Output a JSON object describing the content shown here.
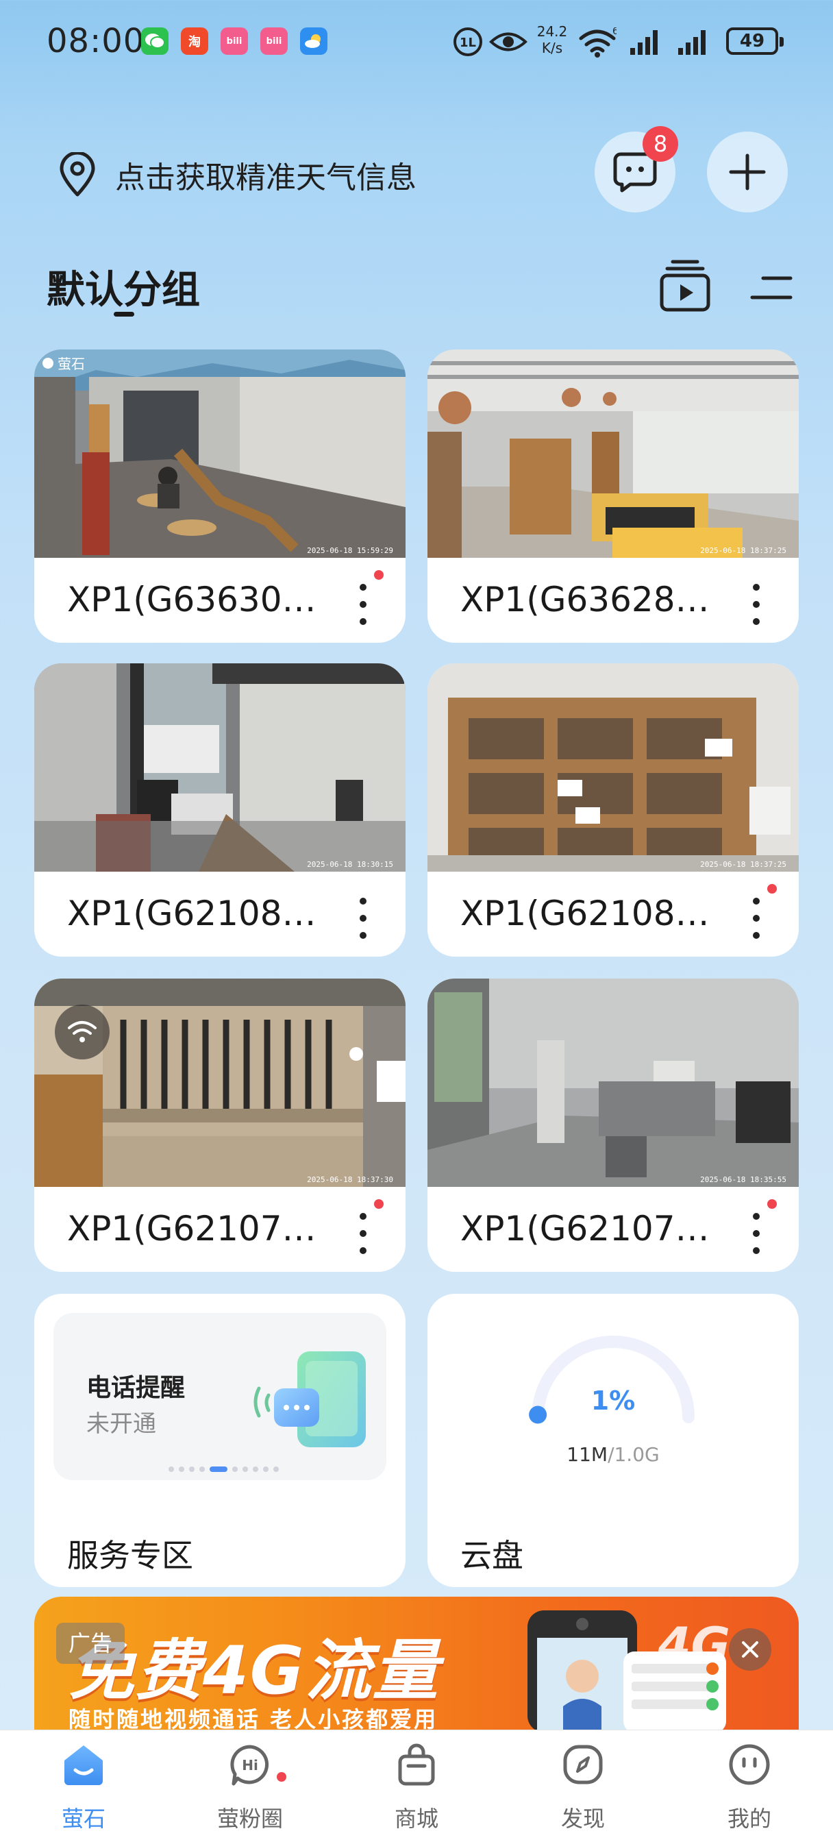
{
  "status_bar": {
    "time": "08:00",
    "net_speed": "24.2",
    "net_unit": "K/s",
    "battery": "49",
    "apps": [
      {
        "name": "wechat-icon",
        "color": "#2dc14f",
        "glyph": "✆"
      },
      {
        "name": "taobao-icon",
        "color": "#f04a2a",
        "glyph": "淘"
      },
      {
        "name": "bilibili-icon",
        "color": "#f25d8e",
        "glyph": "bili"
      },
      {
        "name": "bilibili-icon-2",
        "color": "#f25d8e",
        "glyph": "bili"
      },
      {
        "name": "weather-app-icon",
        "color": "#2f8ff0",
        "glyph": "☁"
      }
    ]
  },
  "header": {
    "location_text": "点击获取精准天气信息",
    "message_badge": "8"
  },
  "group": {
    "title": "默认分组"
  },
  "devices": [
    {
      "name": "XP1(G63630…",
      "timestamp": "2025-06-18 15:59:29",
      "has_dot": true,
      "brand_watermark": "萤石"
    },
    {
      "name": "XP1(G63628…",
      "timestamp": "2025-06-18 18:37:25",
      "has_dot": false
    },
    {
      "name": "XP1(G62108…",
      "timestamp": "2025-06-18 18:30:15",
      "has_dot": false
    },
    {
      "name": "XP1(G62108…",
      "timestamp": "2025-06-18 18:37:25",
      "has_dot": true
    },
    {
      "name": "XP1(G62107…",
      "timestamp": "2025-06-18 18:37:30",
      "has_dot": true
    },
    {
      "name": "XP1(G62107…",
      "timestamp": "2025-06-18 18:35:55",
      "has_dot": true
    }
  ],
  "service": {
    "title": "电话提醒",
    "subtitle": "未开通",
    "label": "服务专区",
    "carousel_count": 10,
    "carousel_active": 4
  },
  "cloud": {
    "percent": "1%",
    "percent_value": 0.01,
    "used": "11M",
    "total": "/1.0G",
    "label": "云盘"
  },
  "ad": {
    "tag": "广告",
    "headline": "免费4G流量",
    "sub": "随时随地视频通话 老人小孩都爱用",
    "badge": "4G"
  },
  "nav": {
    "items": [
      {
        "label": "萤石",
        "icon": "home-icon",
        "active": true
      },
      {
        "label": "萤粉圈",
        "icon": "community-icon",
        "active": false
      },
      {
        "label": "商城",
        "icon": "shop-bag-icon",
        "active": false
      },
      {
        "label": "发现",
        "icon": "compass-icon",
        "active": false
      },
      {
        "label": "我的",
        "icon": "profile-icon",
        "active": false
      }
    ]
  },
  "colors": {
    "accent": "#3d8ef0",
    "badge_red": "#f0454f"
  }
}
